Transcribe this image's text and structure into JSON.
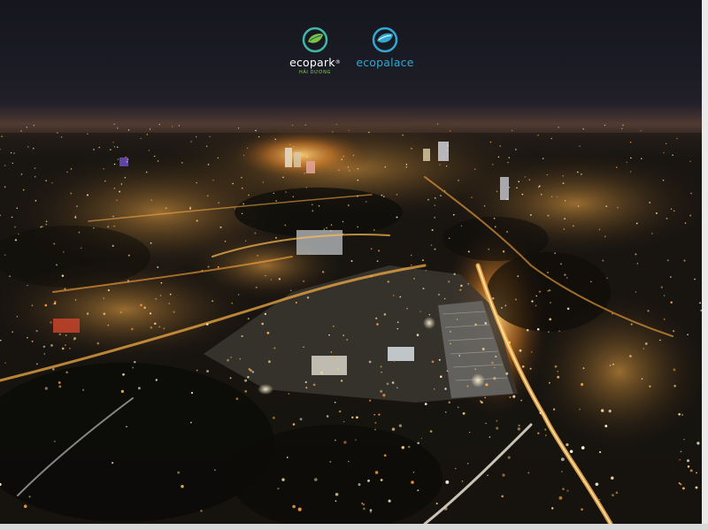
{
  "image": {
    "scene": "Aerial night cityscape",
    "palette": {
      "sky": "#1a1b24",
      "glow": "#ffb44a",
      "ground": "#14120e"
    }
  },
  "logos": {
    "ecopark": {
      "name": "ecopark",
      "mark": "®",
      "subtitle": "HẢI DƯƠNG",
      "icon": "leaf-circle-icon",
      "color": "#3fb7a4"
    },
    "ecopalace": {
      "name": "ecopalace",
      "icon": "leaf-circle-icon",
      "color": "#32a7cf"
    }
  }
}
